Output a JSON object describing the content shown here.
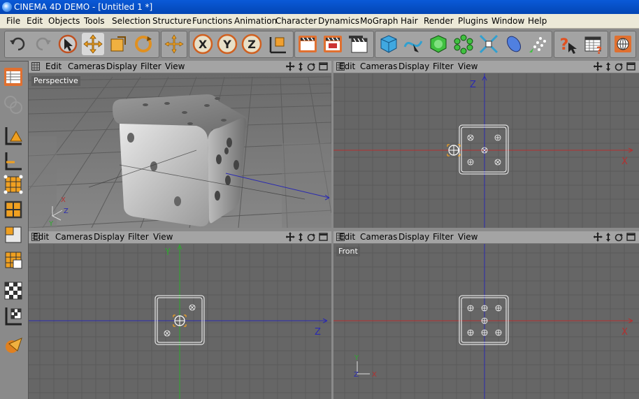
{
  "window": {
    "title": "CINEMA 4D DEMO - [Untitled 1 *]"
  },
  "menu": [
    "File",
    "Edit",
    "Objects",
    "Tools",
    "Selection",
    "Structure",
    "Functions",
    "Animation",
    "Character",
    "Dynamics",
    "MoGraph",
    "Hair",
    "Render",
    "Plugins",
    "Window",
    "Help"
  ],
  "viewport_menu": {
    "edit": "Edit",
    "cameras": "Cameras",
    "display": "Display",
    "filter": "Filter",
    "view": "View"
  },
  "viewports": {
    "top_left": {
      "label": "Perspective"
    },
    "bottom_right": {
      "label": "Front"
    }
  },
  "axes": {
    "x": "X",
    "y": "Y",
    "z": "Z"
  },
  "toolbar_icons": [
    "undo-icon",
    "redo-icon",
    "live-selection-icon",
    "move-icon",
    "scale-icon",
    "rotate-icon",
    "object-axis-icon",
    "x-lock-icon",
    "y-lock-icon",
    "z-lock-icon",
    "coordinate-system-icon",
    "render-view-icon",
    "render-picture-viewer-icon",
    "render-settings-icon",
    "cube-primitive-icon",
    "spline-pen-icon",
    "subdivision-surface-icon",
    "array-icon",
    "deformer-icon",
    "scene-icon",
    "environment-icon",
    "help-icon",
    "layout-icon",
    "browser-icon"
  ],
  "left_toolbar_icons": [
    "make-editable-icon",
    "model-mode-icon",
    "object-mode-icon",
    "axis-mode-icon",
    "points-mode-icon",
    "edges-mode-icon",
    "polygons-mode-icon",
    "uv-mode-icon",
    "texture-mode-icon",
    "workplane-icon",
    "snapping-icon"
  ],
  "colors": {
    "x_axis": "#b43030",
    "y_axis": "#2fa82f",
    "z_axis": "#2a2ab0",
    "viewport_bg": "#666666",
    "grid": "#5a5a5a"
  }
}
